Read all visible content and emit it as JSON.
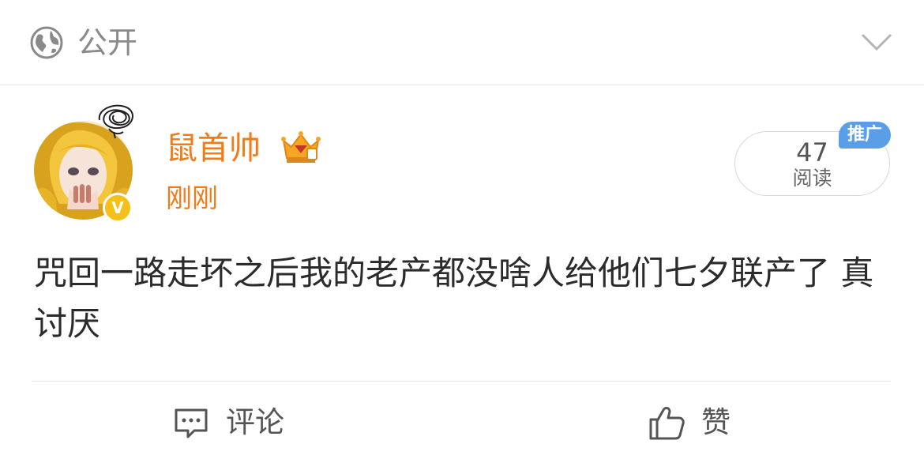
{
  "header": {
    "visibility_label": "公开",
    "globe_icon": "globe-icon",
    "expand_icon": "chevron-down-icon"
  },
  "post": {
    "author": {
      "name": "鼠首帅",
      "avatar_icon": "avatar",
      "badge_icon": "crown-vip-icon",
      "verified_badge": "V"
    },
    "time": "刚刚",
    "read_count": "47",
    "read_label": "阅读",
    "promo_tag": "推广",
    "text": "咒回一路走坏之后我的老产都没啥人给他们七夕联产了 真讨厌"
  },
  "actions": {
    "comment_label": "评论",
    "like_label": "赞"
  },
  "colors": {
    "accent_orange": "#f07b17",
    "promo_blue": "#5b9ee8",
    "verified_yellow": "#f5c017"
  }
}
